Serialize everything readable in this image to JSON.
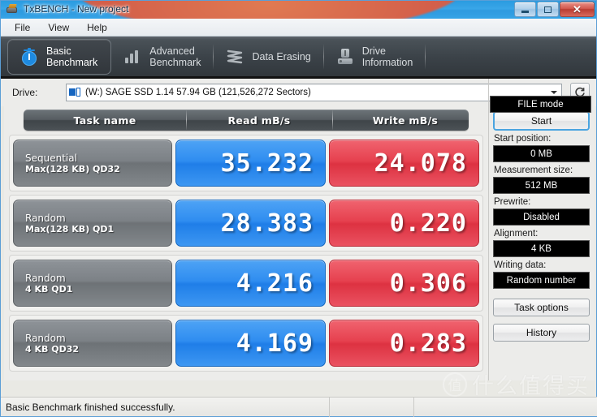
{
  "window": {
    "title": "TxBENCH - New project",
    "icon": "drive-app-icon",
    "buttons": {
      "minimize": "–",
      "maximize": "□",
      "close": "✕"
    }
  },
  "menubar": {
    "items": [
      "File",
      "View",
      "Help"
    ]
  },
  "tabs": [
    {
      "label": "Basic\nBenchmark",
      "icon": "stopwatch-icon",
      "active": true
    },
    {
      "label": "Advanced\nBenchmark",
      "icon": "bar-chart-icon",
      "active": false
    },
    {
      "label": "Data Erasing",
      "icon": "eraser-zigzag-icon",
      "active": false
    },
    {
      "label": "Drive\nInformation",
      "icon": "hard-drive-icon",
      "active": false
    }
  ],
  "drive": {
    "label": "Drive:",
    "selected": "(W:) SAGE SSD 1.14  57.94 GB (121,526,272 Sectors)",
    "refresh_icon": "refresh-icon",
    "dropdown_icon": "chevron-down-icon"
  },
  "table": {
    "headers": [
      "Task name",
      "Read mB/s",
      "Write mB/s"
    ],
    "rows": [
      {
        "task_line1": "Sequential",
        "task_line2": "Max(128 KB) QD32",
        "read": "35.232",
        "write": "24.078"
      },
      {
        "task_line1": "Random",
        "task_line2": "Max(128 KB) QD1",
        "read": "28.383",
        "write": "0.220"
      },
      {
        "task_line1": "Random",
        "task_line2": "4 KB QD1",
        "read": "4.216",
        "write": "0.306"
      },
      {
        "task_line1": "Random",
        "task_line2": "4 KB QD32",
        "read": "4.169",
        "write": "0.283"
      }
    ]
  },
  "sidebar": {
    "mode_display": "FILE mode",
    "start_button": "Start",
    "start_position_caption": "Start position:",
    "start_position_value": "0 MB",
    "measurement_size_caption": "Measurement size:",
    "measurement_size_value": "512 MB",
    "prewrite_caption": "Prewrite:",
    "prewrite_value": "Disabled",
    "alignment_caption": "Alignment:",
    "alignment_value": "4 KB",
    "writing_data_caption": "Writing data:",
    "writing_data_value": "Random number",
    "task_options_button": "Task options",
    "history_button": "History"
  },
  "statusbar": {
    "message": "Basic Benchmark finished successfully.",
    "segment2": "",
    "segment3": ""
  },
  "watermark": {
    "logo": "值",
    "text": "什么值得买"
  },
  "colors": {
    "read_bar": "#2f8df0",
    "write_bar": "#e6414f",
    "tab_strip": "#3c4349",
    "title_bar": "#2e9adf",
    "title_arc": "#d35f4a"
  }
}
